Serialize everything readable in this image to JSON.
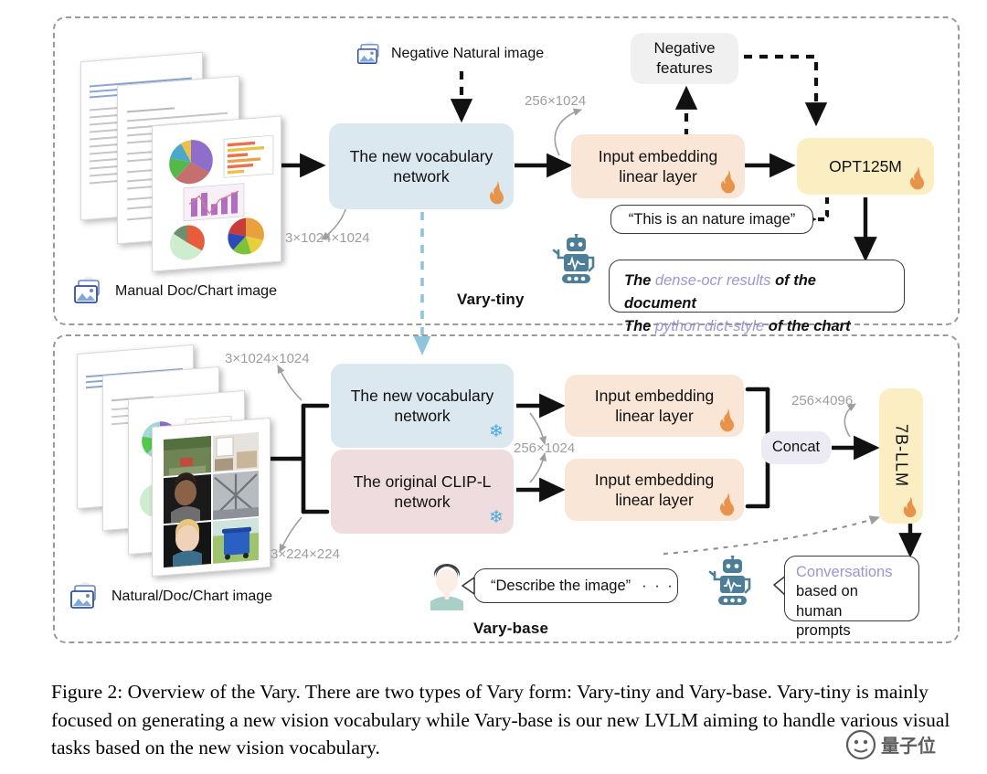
{
  "figure": {
    "caption": "Figure 2: Overview of the Vary. There are two types of Vary form: Vary-tiny and Vary-base. Vary-tiny is mainly focused on generating a new vision vocabulary while Vary-base is our new LVLM aiming to handle various visual tasks based on the new vision vocabulary."
  },
  "tiny": {
    "panel_label": "Vary-tiny",
    "input_icon_label": "Manual Doc/Chart image",
    "negative_input_label": "Negative Natural image",
    "vocab_box": "The new vocabulary network",
    "embed_box": "Input embedding linear layer",
    "llm_box": "OPT125M",
    "negative_features": "Negative features",
    "dim_input": "3×1024×1024",
    "dim_tokens": "256×1024",
    "speech_bubble": "“This is an nature image”",
    "output_line1_a": "The ",
    "output_line1_b": "dense-ocr results",
    "output_line1_c": " of the document",
    "output_line2_a": "The ",
    "output_line2_b": "python dict-style",
    "output_line2_c": " of the chart"
  },
  "base": {
    "panel_label": "Vary-base",
    "input_icon_label": "Natural/Doc/Chart image",
    "vocab_box": "The new vocabulary network",
    "clip_box": "The original CLIP-L network",
    "embed_box_top": "Input embedding linear layer",
    "embed_box_bottom": "Input embedding linear layer",
    "concat_box": "Concat",
    "llm_box": "7B-LLM",
    "dim_vocab_input": "3×1024×1024",
    "dim_clip_input": "3×224×224",
    "dim_tokens": "256×1024",
    "dim_concat": "256×4096",
    "user_prompt": "“Describe the image”",
    "user_prompt_ellipsis": "· · ·",
    "conv_line1": "Conversations",
    "conv_line2": "based on human",
    "conv_line3": "prompts"
  },
  "icons": {
    "image_stack": "image-stack-icon",
    "flame": "flame-icon",
    "snowflake": "snowflake-icon",
    "robot": "robot-icon",
    "person": "person-icon"
  },
  "colors": {
    "vocab": "#dbe8ef",
    "clip": "#eedcdf",
    "embed": "#fae6d6",
    "llm": "#fbeec3",
    "neutral": "#f0f0f0",
    "concat": "#eceaf2",
    "dim_text": "#9e9e9e",
    "accent_purple": "#9a96d6",
    "flame": "#e8934a",
    "snowflake": "#4aa8dd",
    "robot": "#4c7f97",
    "panel_border": "#9a9a9a"
  }
}
